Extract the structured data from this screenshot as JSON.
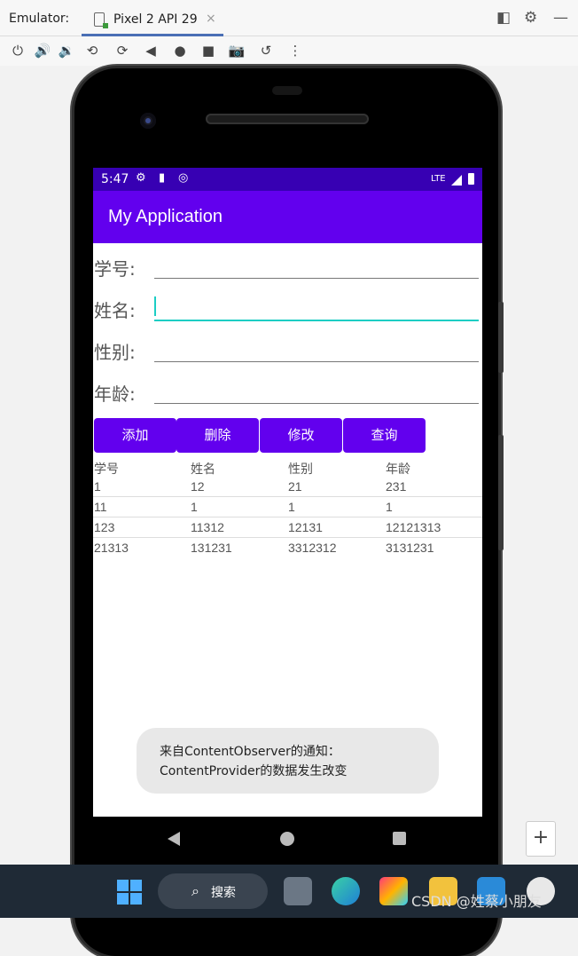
{
  "ide": {
    "emulator_label": "Emulator:",
    "tab_label": "Pixel 2 API 29",
    "tab_close": "×",
    "icons": [
      "power-icon",
      "volume-up-icon",
      "volume-down-icon",
      "rotate-left-icon",
      "rotate-right-icon",
      "back-icon",
      "home-icon",
      "overview-icon",
      "camera-icon",
      "snapshot-icon",
      "more-icon"
    ]
  },
  "device": {
    "status_time": "5:47",
    "status_network": "LTE",
    "app_title": "My Application",
    "fields": [
      {
        "label": "学号:",
        "value": ""
      },
      {
        "label": "姓名:",
        "value": ""
      },
      {
        "label": "性别:",
        "value": ""
      },
      {
        "label": "年龄:",
        "value": ""
      }
    ],
    "buttons": [
      "添加",
      "删除",
      "修改",
      "查询"
    ],
    "table": {
      "headers": [
        "学号",
        "姓名",
        "性别",
        "年龄"
      ],
      "rows": [
        [
          "1",
          "12",
          "21",
          "231"
        ],
        [
          "11",
          "1",
          "1",
          "1"
        ],
        [
          "123",
          "11312",
          "12131",
          "12121313"
        ],
        [
          "21313",
          "131231",
          "3312312",
          "3131231"
        ]
      ]
    },
    "toast": {
      "line1": "来自ContentObserver的通知：",
      "line2": "ContentProvider的数据发生改变"
    }
  },
  "zoom_label": "+",
  "taskbar": {
    "search_label": "搜索"
  },
  "watermark": "CSDN @姓蔡小朋友",
  "colors": {
    "status_bar": "#3700b3",
    "app_bar": "#6200ee",
    "accent": "#1ccdc4"
  }
}
